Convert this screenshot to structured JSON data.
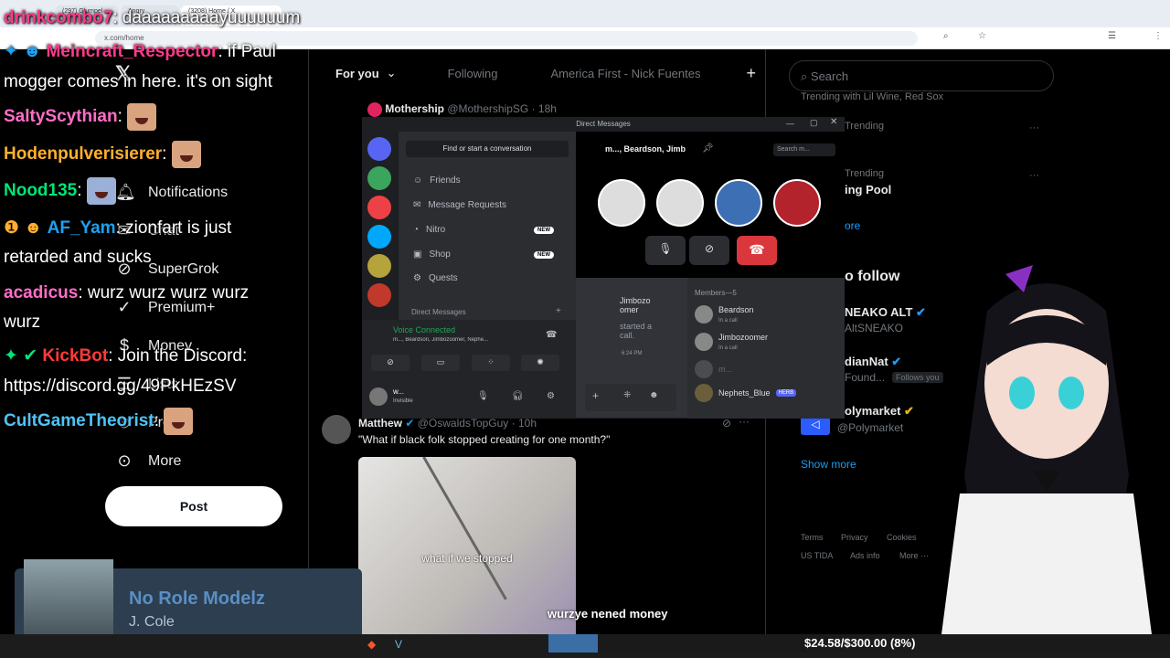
{
  "browser": {
    "tabs": [
      "(297) Glumpel",
      "Angry",
      "(3208) Home / X"
    ],
    "url": "x.com/home"
  },
  "nav": {
    "items": [
      {
        "label": "Notifications",
        "icon": "bell-icon"
      },
      {
        "label": "Chat",
        "icon": "chat-icon"
      },
      {
        "label": "SuperGrok",
        "icon": "grok-icon"
      },
      {
        "label": "Premium+",
        "icon": "x-premium-icon"
      },
      {
        "label": "Money",
        "icon": "money-icon"
      },
      {
        "label": "Lists",
        "icon": "list-icon"
      },
      {
        "label": "Profile",
        "icon": "profile-icon"
      },
      {
        "label": "More",
        "icon": "more-icon"
      }
    ],
    "post_label": "Post"
  },
  "chat": [
    {
      "user": "drinkcombo7",
      "text": ": daaaaaaaaayuuuuuum",
      "color": "#ff3a8c"
    },
    {
      "user": "Meincraft_Respector",
      "text": ": if Paul",
      "color": "#ff3a8c"
    },
    {
      "user": "",
      "text": "mogger comes in here. it's on sight",
      "color": "#fff"
    },
    {
      "user": "SaltyScythian",
      "text": ":",
      "color": "#ff6ec7"
    },
    {
      "user": "Hodenpulverisierer",
      "text": ":",
      "color": "#ffb02e"
    },
    {
      "user": "Nood135",
      "text": ":",
      "color": "#00e676"
    },
    {
      "user": "AF_Yam",
      "text": ": zionfart is just",
      "color": "#1da1f2"
    },
    {
      "user": "",
      "text": "retarded and sucks",
      "color": "#fff"
    },
    {
      "user": "acadicus",
      "text": ": wurz wurz wurz wurz",
      "color": "#ff6ec7"
    },
    {
      "user": "",
      "text": "wurz",
      "color": "#fff"
    },
    {
      "user": "KickBot",
      "text": ": Join the Discord:",
      "color": "#ff3a3a"
    },
    {
      "user": "",
      "text": "https://discord.gg/49PkHEzSV",
      "color": "#fff"
    },
    {
      "user": "CultGameTheorist",
      "text": ":",
      "color": "#4fc3f7"
    }
  ],
  "main": {
    "tabs": [
      "For you",
      "Following",
      "America First - Nick Fuentes"
    ],
    "tweet1": {
      "name": "Mothership",
      "handle": "@MothershipSG · 18h"
    },
    "tweet2": {
      "name": "Matthew",
      "handle": "@OswaldsTopGuy · 10h",
      "text": "\"What if black folk stopped creating for one month?\""
    },
    "media_caption": "what if we stopped"
  },
  "right": {
    "search_placeholder": "Search",
    "trend_top": "Trending with Lil Wine, Red Sox",
    "trend1": "Trending",
    "trend2_label": "Trending",
    "trend2": "ing Pool",
    "more": "ore",
    "who_follow": "o follow",
    "follow1_name": "NEAKO ALT",
    "follow1_handle": "AltSNEAKO",
    "follow2_name": "dianNat",
    "follow2_handle": "Found...",
    "follows_you": "Follows you",
    "follow3_name": "olymarket",
    "follow3_handle": "@Polymarket",
    "show_more": "Show more",
    "footer": [
      "Terms",
      "Privacy",
      "Cookies",
      "US TIDA",
      "Ads info",
      "More ···"
    ]
  },
  "discord": {
    "title": "Direct Messages",
    "find": "Find or start a conversation",
    "items": [
      "Friends",
      "Message Requests",
      "Nitro",
      "Shop",
      "Quests"
    ],
    "new_badge": "NEW",
    "dm_header": "Direct Messages",
    "voice_connected": "Voice Connected",
    "voice_sub": "m..., Beardson, Jimbozoomer, Nephe...",
    "user": "w...",
    "user_status": "Invisible",
    "call_title": "m..., Beardson, Jimb",
    "search": "Search m...",
    "msg_user": "Jimbozo omer",
    "msg_text": "started a call.",
    "msg_time": "6:24 PM",
    "members_header": "Members—5",
    "members": [
      {
        "name": "Beardson",
        "status": "In a call"
      },
      {
        "name": "Jimbozoomer",
        "status": "In a call"
      },
      {
        "name": "m...",
        "status": ""
      },
      {
        "name": "Nephets_Blue",
        "status": ""
      }
    ],
    "herb_tag": "HERB"
  },
  "nowplaying": {
    "title": "No Role Modelz",
    "artist": "J. Cole"
  },
  "subtitle": "wurzye nened money",
  "goal": {
    "text": "$24.58/$300.00 (8%)",
    "fraction": 0.08
  }
}
